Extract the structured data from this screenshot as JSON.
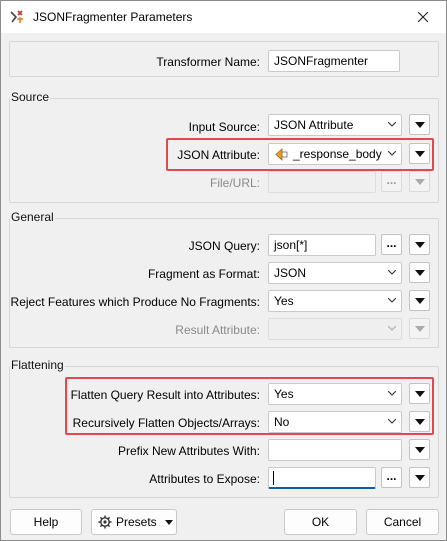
{
  "window": {
    "title": "JSONFragmenter Parameters"
  },
  "transformer": {
    "label": "Transformer Name:",
    "value": "JSONFragmenter"
  },
  "source": {
    "title": "Source",
    "input_source": {
      "label": "Input Source:",
      "value": "JSON Attribute"
    },
    "json_attribute": {
      "label": "JSON Attribute:",
      "value": "_response_body"
    },
    "file_url": {
      "label": "File/URL:",
      "value": ""
    }
  },
  "general": {
    "title": "General",
    "json_query": {
      "label": "JSON Query:",
      "value": "json[*]"
    },
    "fragment_format": {
      "label": "Fragment as Format:",
      "value": "JSON"
    },
    "reject": {
      "label": "Reject Features which Produce No Fragments:",
      "value": "Yes"
    },
    "result_attribute": {
      "label": "Result Attribute:",
      "value": ""
    }
  },
  "flattening": {
    "title": "Flattening",
    "flatten_query": {
      "label": "Flatten Query Result into Attributes:",
      "value": "Yes"
    },
    "recursive": {
      "label": "Recursively Flatten Objects/Arrays:",
      "value": "No"
    },
    "prefix": {
      "label": "Prefix New Attributes With:",
      "value": ""
    },
    "expose": {
      "label": "Attributes to Expose:",
      "value": ""
    }
  },
  "footer": {
    "help": "Help",
    "presets": "Presets",
    "ok": "OK",
    "cancel": "Cancel"
  },
  "ellipsis": "...",
  "colors": {
    "highlight": "#e04a4a",
    "accent": "#0a5ea8"
  }
}
